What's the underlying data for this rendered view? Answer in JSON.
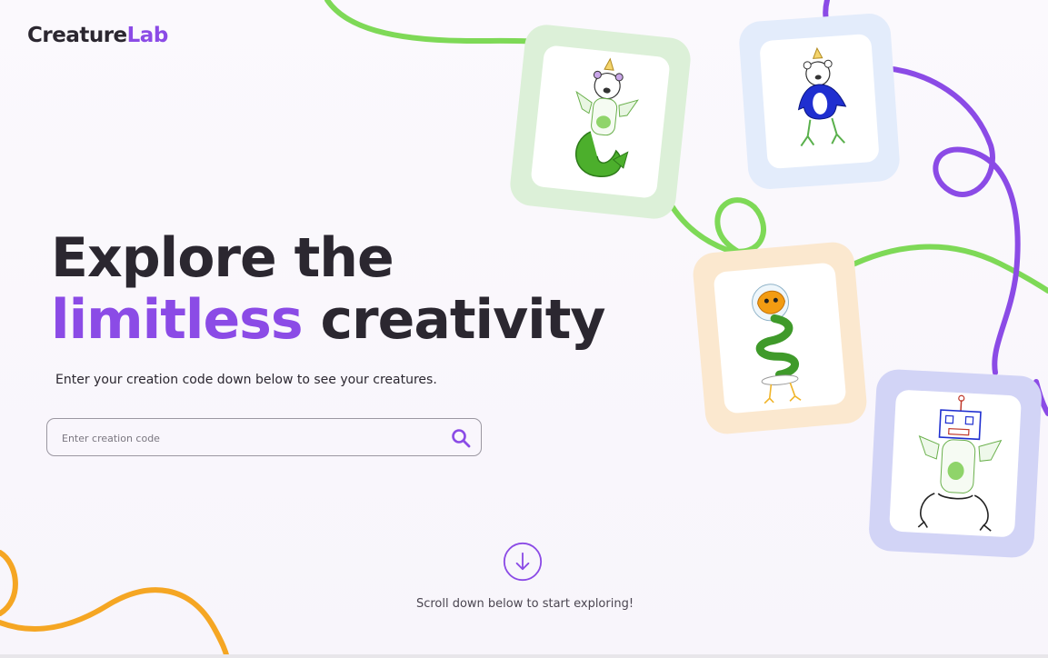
{
  "brand": {
    "name_part1": "Creature",
    "name_part2": "Lab"
  },
  "hero": {
    "line1": "Explore the",
    "accent": "limitless",
    "line2_rest": " creativity",
    "subtitle": "Enter your creation code down below to see your creatures."
  },
  "search": {
    "placeholder": "Enter creation code",
    "value": ""
  },
  "scroll": {
    "text": "Scroll down below to start exploring!"
  },
  "colors": {
    "accent": "#8b4be6",
    "green": "#7ed957",
    "orange": "#f5a623",
    "text": "#2b2730"
  },
  "gallery": [
    {
      "name": "creature-bear-mermaid",
      "frame_color": "#dcf0d8"
    },
    {
      "name": "creature-bear-penguin",
      "frame_color": "#e3ecfb"
    },
    {
      "name": "creature-fish-snake",
      "frame_color": "#fbe8cf"
    },
    {
      "name": "creature-robot-dragon",
      "frame_color": "#d2d4f6"
    }
  ]
}
